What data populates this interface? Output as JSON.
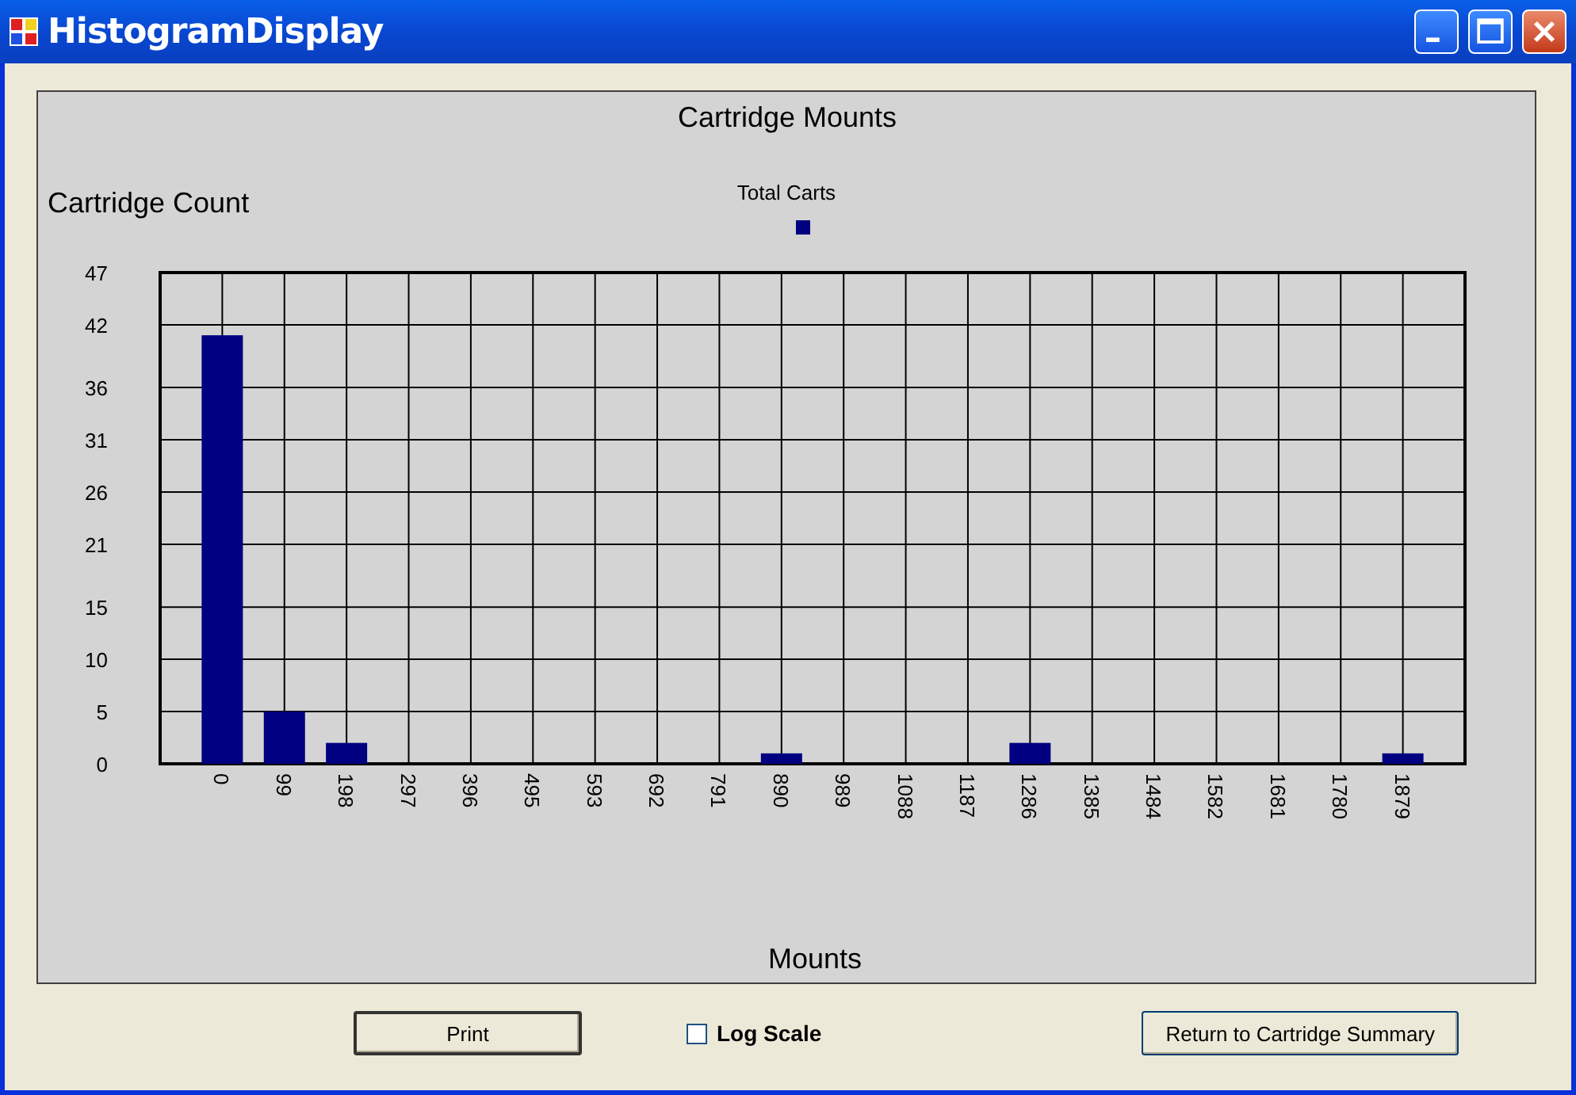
{
  "window": {
    "title": "HistogramDisplay"
  },
  "chart": {
    "chart_data": {
      "type": "bar",
      "title": "Cartridge Mounts",
      "xlabel": "Mounts",
      "ylabel": "Cartridge Count",
      "categories": [
        "0",
        "99",
        "198",
        "297",
        "396",
        "495",
        "593",
        "692",
        "791",
        "890",
        "989",
        "1088",
        "1187",
        "1286",
        "1385",
        "1484",
        "1582",
        "1681",
        "1780",
        "1879"
      ],
      "series": [
        {
          "name": "Total Carts",
          "color": "#000080",
          "values": [
            41,
            5,
            2,
            0,
            0,
            0,
            0,
            0,
            0,
            1,
            0,
            0,
            0,
            2,
            0,
            0,
            0,
            0,
            0,
            1
          ]
        }
      ],
      "grid": true,
      "ylim": [
        0,
        47
      ],
      "yticks": [
        0,
        5,
        10,
        15,
        21,
        26,
        31,
        36,
        42,
        47
      ]
    }
  },
  "buttons": {
    "print": "Print",
    "return": "Return to Cartridge Summary"
  },
  "log_scale": {
    "label": "Log Scale",
    "checked": false
  }
}
